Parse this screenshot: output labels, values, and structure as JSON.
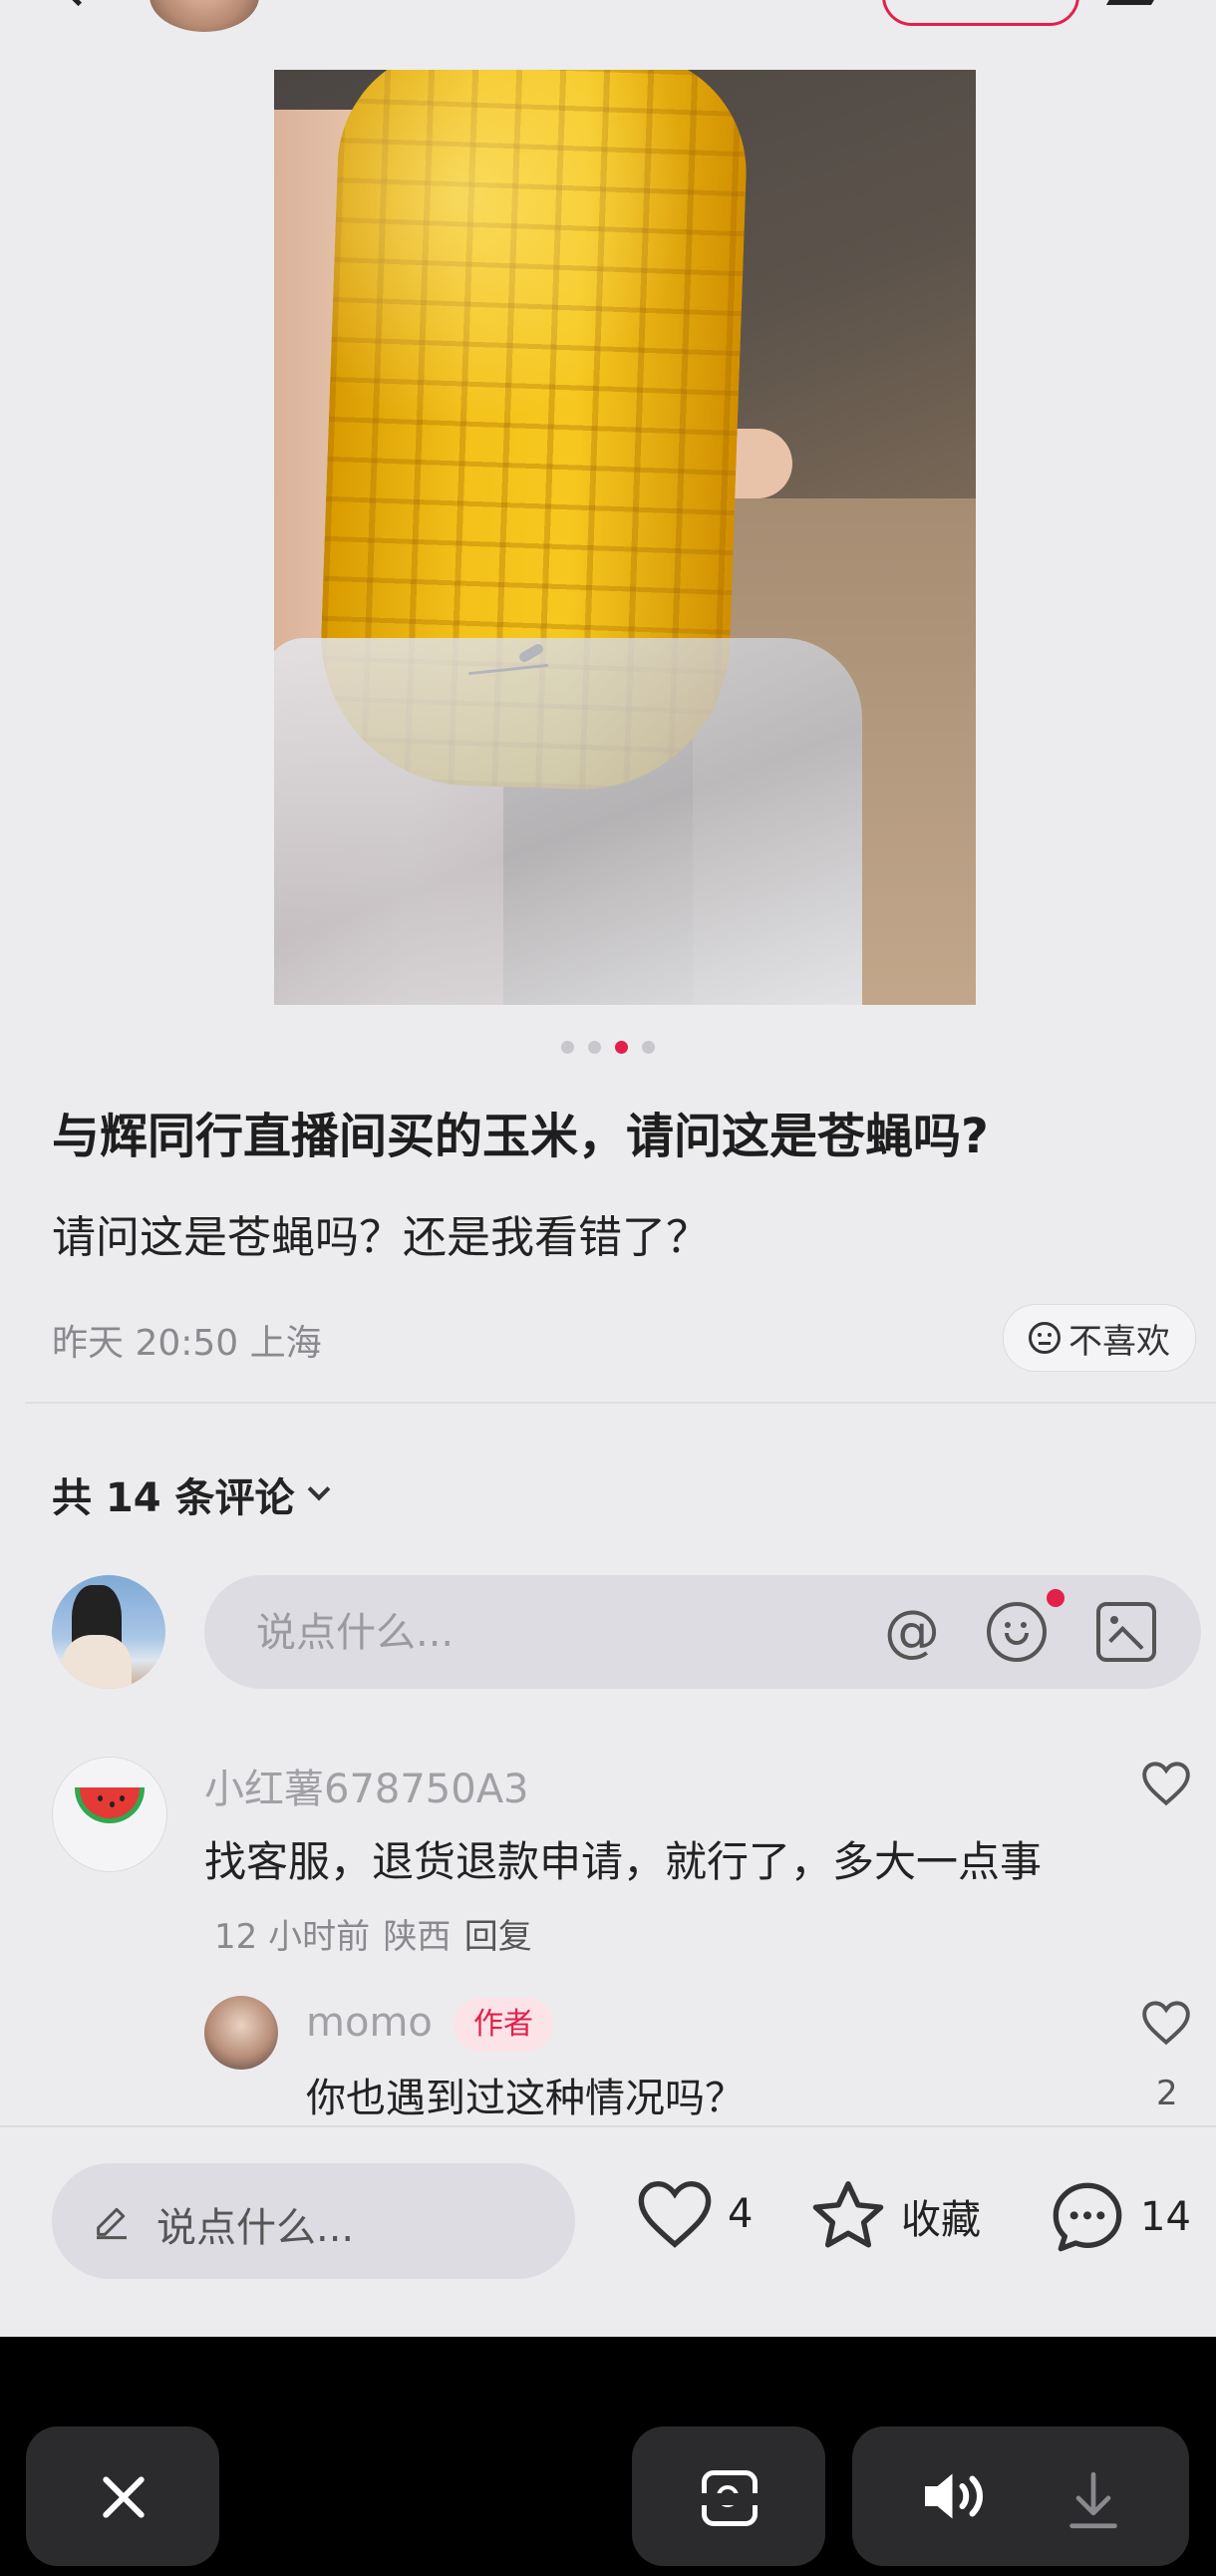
{
  "post": {
    "title": "与辉同行直播间买的玉米，请问这是苍蝇吗?",
    "description": "请问这是苍蝇吗？还是我看错了？",
    "meta": "昨天 20:50 上海",
    "dislike_label": "不喜欢",
    "carousel": {
      "total": 4,
      "active_index": 2
    }
  },
  "comments_header": {
    "label": "共 14 条评论"
  },
  "comment_input": {
    "placeholder": "说点什么..."
  },
  "comments": [
    {
      "user": "小红薯678750A3",
      "text": "找客服，退货退款申请，就行了，多大一点事",
      "time": "12 小时前",
      "location": "陕西",
      "reply_label": "回复",
      "replies": [
        {
          "user": "momo",
          "badge": "作者",
          "text": "你也遇到过这种情况吗？",
          "likes": "2"
        }
      ]
    }
  ],
  "bottom_bar": {
    "input_placeholder": "说点什么...",
    "likes": "4",
    "favorite_label": "收藏",
    "comments": "14"
  },
  "colors": {
    "accent": "#e3204a",
    "background": "#ececef"
  },
  "icons": [
    "back-icon",
    "share-icon",
    "dislike-face-icon",
    "chevron-down-icon",
    "at-icon",
    "emoji-icon",
    "image-icon",
    "heart-icon",
    "pencil-icon",
    "star-icon",
    "comment-bubble-icon",
    "close-icon",
    "lens-icon",
    "speaker-icon",
    "download-icon"
  ]
}
